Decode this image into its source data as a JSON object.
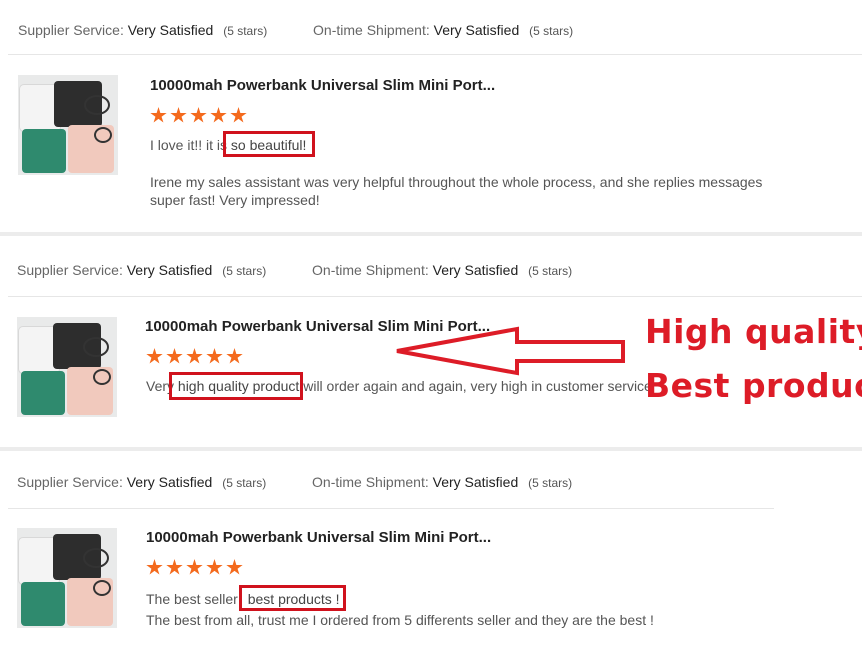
{
  "meta": {
    "supplier_label": "Supplier Service:",
    "supplier_value": "Very Satisfied",
    "supplier_stars": "(5 stars)",
    "shipment_label": "On-time Shipment:",
    "shipment_value": "Very Satisfied",
    "shipment_stars": "(5 stars)"
  },
  "product_title": "10000mah Powerbank Universal Slim Mini Port...",
  "rating": {
    "stars": 5,
    "max": 5
  },
  "reviews": [
    {
      "line1_pre": "I love it!! it is",
      "line1_highlight": "so beautiful!",
      "line2": "Irene my sales assistant was very helpful throughout the whole process, and she replies messages super fast! Very impressed!"
    },
    {
      "line1_pre": "Very",
      "line1_highlight": "high quality product",
      "line1_post": "will order again and again, very high in customer service"
    },
    {
      "line1_pre": "The best seller",
      "line1_highlight": "best products !",
      "line2": "The best from all, trust me I ordered from 5 differents seller and they are the best !"
    }
  ],
  "annotation": {
    "line1": "High quality",
    "line2": "Best product",
    "color": "#dd1c27"
  },
  "colors": {
    "star": "#f46a1d",
    "highlight_box": "#d0121d"
  },
  "icons": {
    "star": "star-icon",
    "annotation_arrow": "left-arrow-icon"
  }
}
